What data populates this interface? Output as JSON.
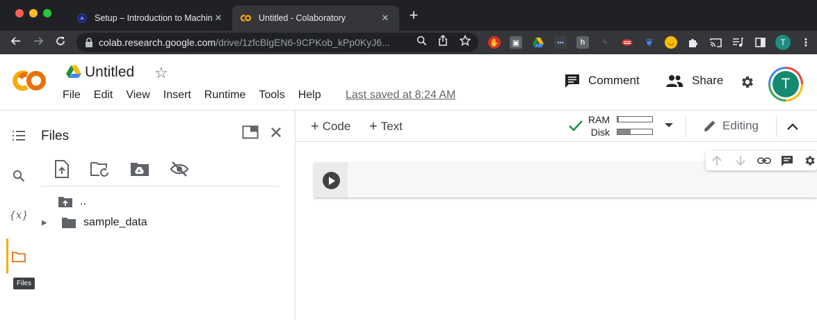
{
  "browser": {
    "tabs": [
      {
        "title": "Setup – Introduction to Machin",
        "active": false,
        "close": "✕"
      },
      {
        "title": "Untitled - Colaboratory",
        "active": true,
        "close": "✕"
      }
    ],
    "new_tab": "+",
    "url_host": "colab.research.google.com",
    "url_path": "/drive/1zfcBlgEN6-9CPKob_kPp0KyJ6...",
    "profile_initial": "T"
  },
  "header": {
    "notebook_title": "Untitled",
    "star": "☆",
    "menu": [
      "File",
      "Edit",
      "View",
      "Insert",
      "Runtime",
      "Tools",
      "Help"
    ],
    "last_saved": "Last saved at 8:24 AM",
    "comment_label": "Comment",
    "share_label": "Share",
    "avatar_initial": "T"
  },
  "rail": {
    "icons": [
      "table-of-contents-icon",
      "search-icon",
      "variables-icon",
      "folder-icon"
    ],
    "variables_glyph": "{x}",
    "tooltip": "Files"
  },
  "files_panel": {
    "title": "Files",
    "close": "✕",
    "tools": [
      "upload-file-icon",
      "refresh-folder-icon",
      "mount-drive-icon",
      "hide-icon"
    ],
    "tree": [
      {
        "name": "..",
        "type": "parent"
      },
      {
        "name": "sample_data",
        "type": "folder",
        "expanded": false,
        "arrow": "▶"
      }
    ]
  },
  "notebook_toolbar": {
    "add_code": "Code",
    "add_text": "Text",
    "plus": "+",
    "ram_label": "RAM",
    "disk_label": "Disk",
    "ram_usage": 0.03,
    "disk_usage": 0.38,
    "editing_label": "Editing"
  },
  "cell_toolbar": {
    "buttons": [
      "move-up-icon",
      "move-down-icon",
      "link-icon",
      "comment-icon",
      "settings-icon"
    ]
  },
  "colors": {
    "colab_orange": "#F9AB00",
    "status_green": "#1E8E3E",
    "avatar_teal": "#148A72"
  }
}
